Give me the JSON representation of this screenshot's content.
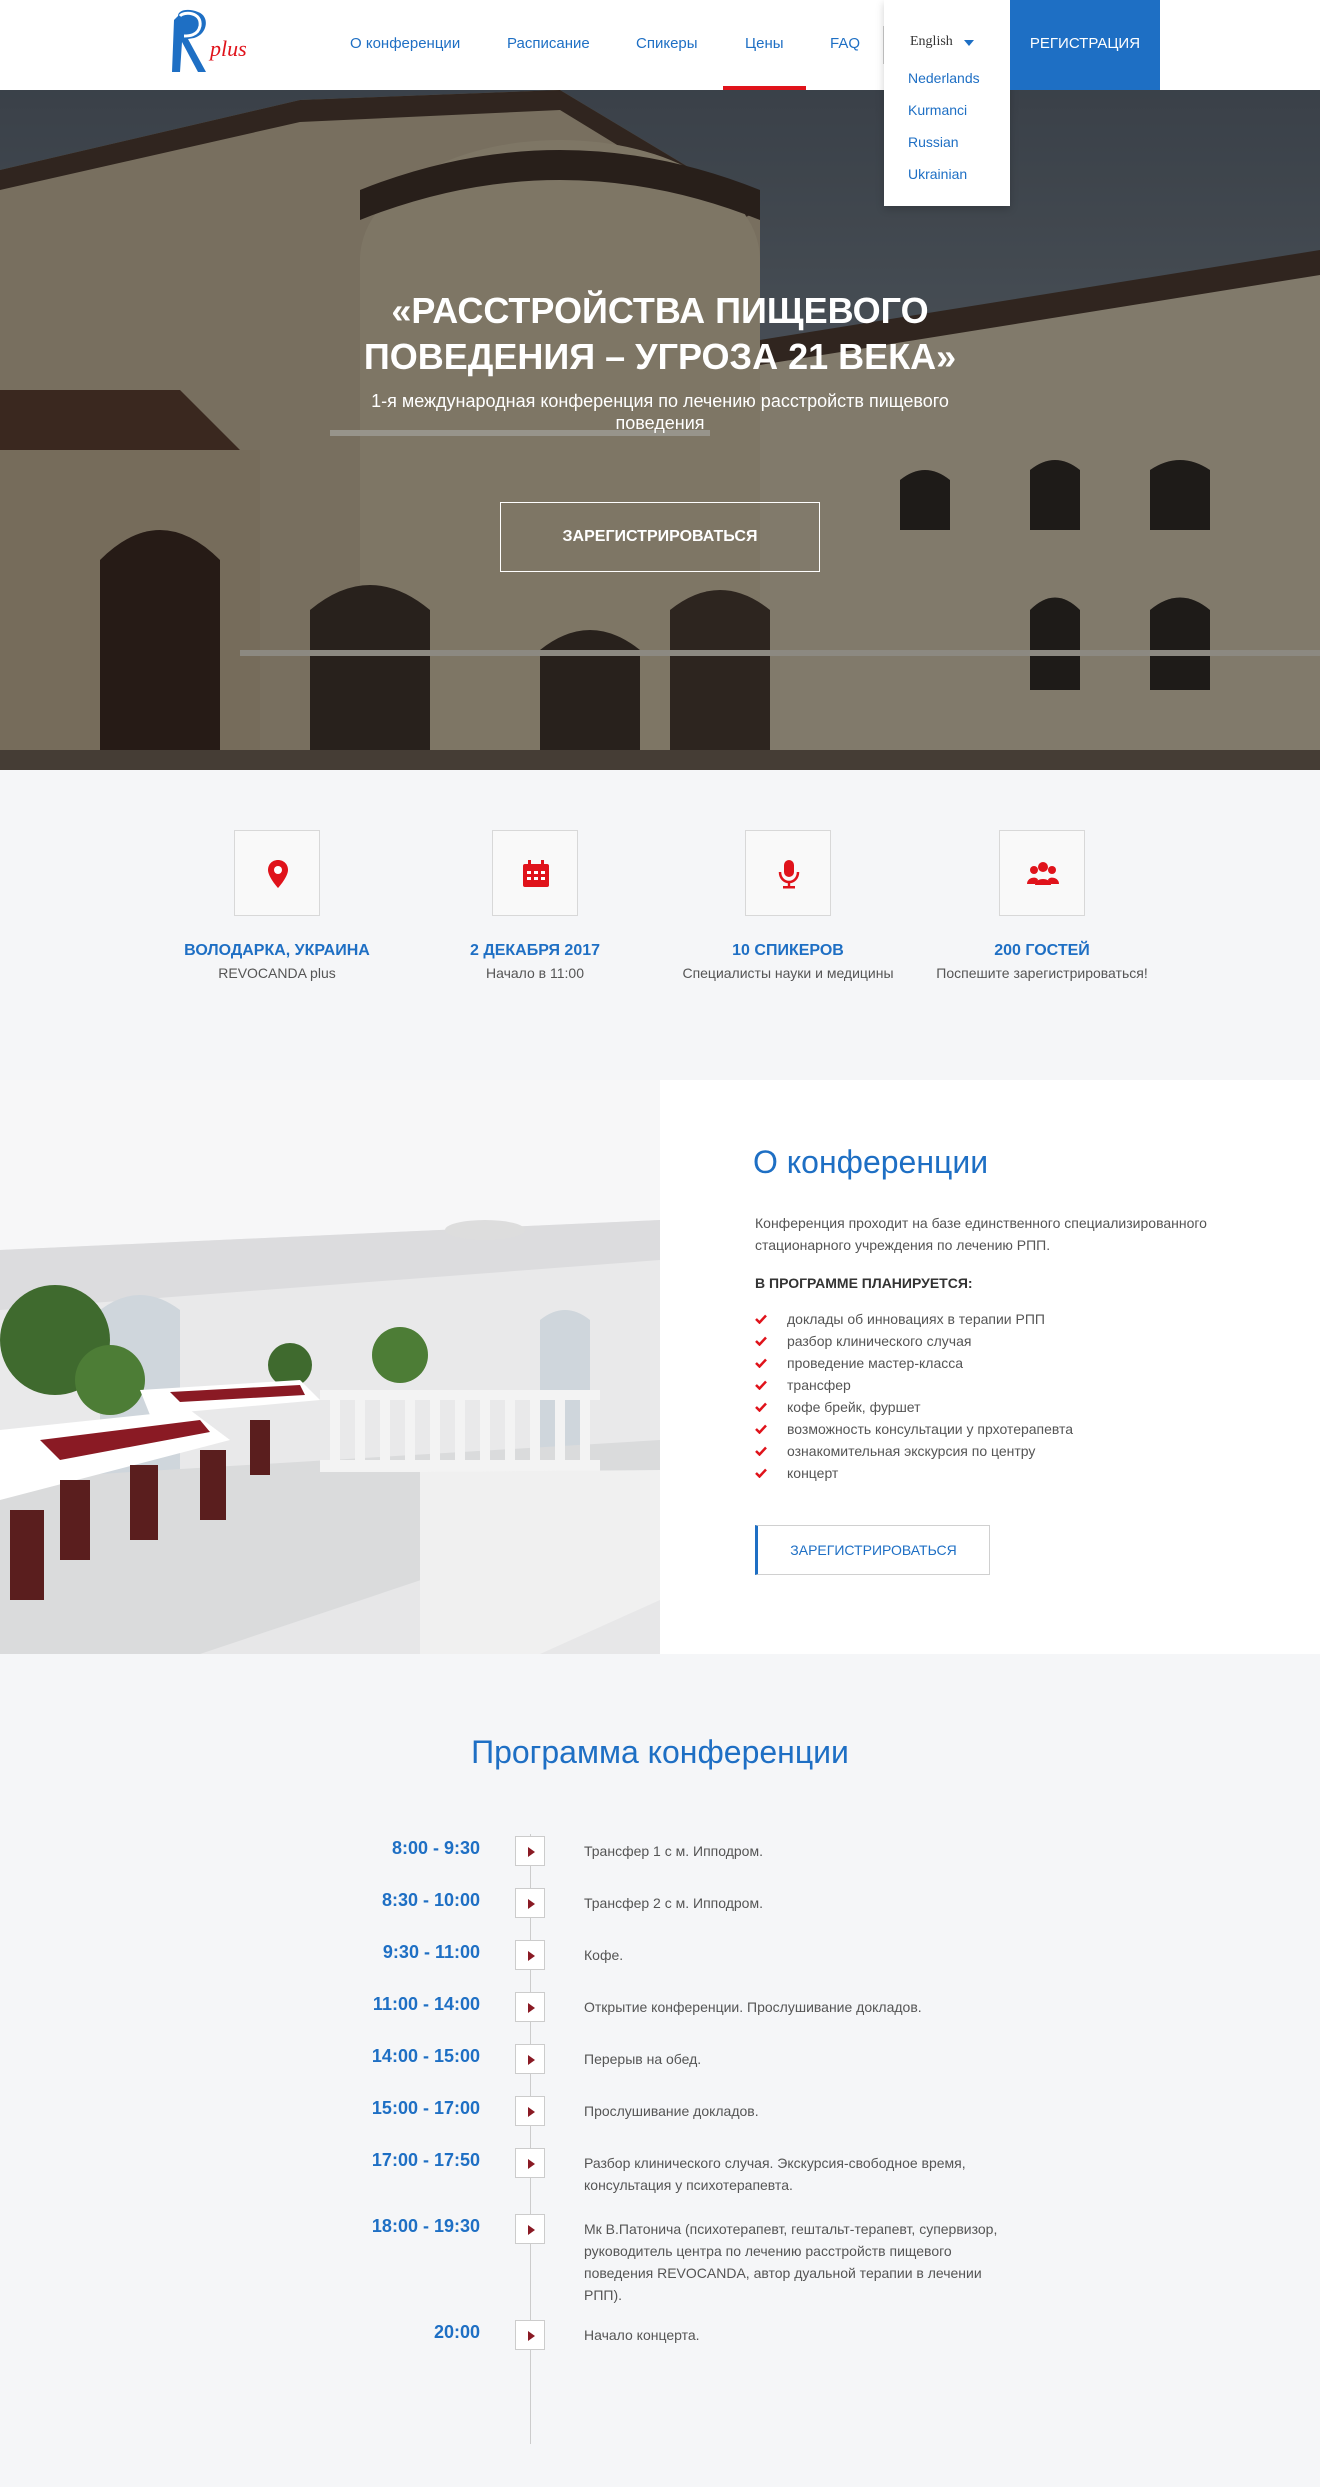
{
  "header": {
    "logo_text": "R plus",
    "nav": [
      {
        "label": "О конференции"
      },
      {
        "label": "Расписание"
      },
      {
        "label": "Спикеры"
      },
      {
        "label": "Цены",
        "active": true
      },
      {
        "label": "FAQ"
      }
    ],
    "language": {
      "current": "English",
      "options": [
        "Nederlands",
        "Kurmanci",
        "Russian",
        "Ukrainian"
      ]
    },
    "register_label": "Регистрация"
  },
  "hero": {
    "title": "«Расстройства пищевого поведения – угроза 21 века»",
    "subtitle": "1-я международная конференция по лечению расстройств пищевого поведения",
    "button_label": "Зарегистрироваться"
  },
  "features": [
    {
      "icon": "location-pin-icon",
      "title": "Володарка, Украина",
      "subtitle": "REVOCANDA plus"
    },
    {
      "icon": "calendar-icon",
      "title": "2 декабря 2017",
      "subtitle": "Начало в 11:00"
    },
    {
      "icon": "microphone-icon",
      "title": "10 спикеров",
      "subtitle": "Специалисты науки и медицины"
    },
    {
      "icon": "users-icon",
      "title": "200 гостей",
      "subtitle": "Поспешите зарегистрироваться!"
    }
  ],
  "about": {
    "title": "О конференции",
    "text": "Конференция проходит на базе единственного специализированного стационарного учреждения по лечению РПП.",
    "plan_heading": "В ПРОГРАММЕ ПЛАНИРУЕТСЯ:",
    "items": [
      "доклады об инновациях в терапии РПП",
      "разбор клинического случая",
      "проведение мастер-класса",
      "трансфер",
      "кофе брейк, фуршет",
      "возможность консультации у прхотерапевта",
      "ознакомительная экскурсия по центру",
      "концерт"
    ],
    "button_label": "Зарегистрироваться"
  },
  "program": {
    "title": "Программа конференции",
    "rows": [
      {
        "time": "8:00 - 9:30",
        "text": "Трансфер 1 с м. Ипподром."
      },
      {
        "time": "8:30 - 10:00",
        "text": "Трансфер 2 с м. Ипподром."
      },
      {
        "time": "9:30 - 11:00",
        "text": "Кофе."
      },
      {
        "time": "11:00 - 14:00",
        "text": "Открытие конференции. Прослушивание докладов."
      },
      {
        "time": "14:00 - 15:00",
        "text": "Перерыв на обед."
      },
      {
        "time": "15:00 - 17:00",
        "text": "Прослушивание докладов."
      },
      {
        "time": "17:00 - 17:50",
        "text": "Разбор клинического случая. Экскурсия-свободное время, консультация у психотерапевта."
      },
      {
        "time": "18:00 - 19:30",
        "text": "Мк В.Патонича (психотерапевт, гештальт-терапевт, супервизор, руководитель центра по лечению расстройств пищевого поведения REVOCANDA, автор дуальной терапии в лечении РПП)."
      },
      {
        "time": "20:00",
        "text": "Начало концерта."
      }
    ]
  },
  "colors": {
    "accent": "#1e6fc4",
    "red": "#e0131b"
  }
}
